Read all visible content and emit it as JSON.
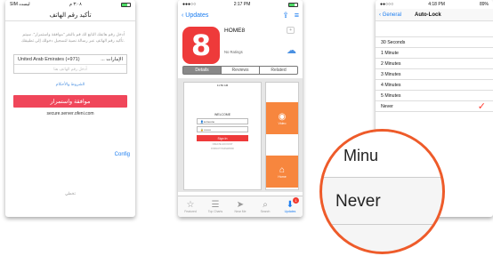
{
  "phone1": {
    "status": {
      "carrier": "SIM ليست",
      "time": "٣:٠٨ م"
    },
    "title": "تأكيد رقم الهاتف",
    "description": "أدخل رقم هاتفك التابع لك قم بالنقر \"موافقة واستمرار\". سيتم تأكيد رقم الهاتف عبر رسالة نصية لتسجيل دخولك إلى تطبيقك.",
    "country_left": "United Arab Emirates (+971)",
    "country_right": "... الإمارات",
    "phone_placeholder": "أدخل رقم الهاتف هنا",
    "terms": "الشروط والأحكام",
    "agree_button": "موافقة واستمرار",
    "site": "secure.server.ofeni.com",
    "config": "Config",
    "skip": "تخطي"
  },
  "phone2": {
    "status": {
      "carrier": "●●●○○",
      "time": "2:17 PM"
    },
    "back": "Updates",
    "app_icon_glyph": "8",
    "app_name": "HOME8",
    "ratings": "No Ratings",
    "plus_badge": "+",
    "tabs": [
      "Details",
      "Reviews",
      "Related"
    ],
    "shot": {
      "time": "11:50 AM",
      "welcome": "WELCOME",
      "username": "someone",
      "password": "••••••••",
      "signin": "Sign In",
      "links": [
        "CREATE ACCOUNT",
        "FORGOT PASSWORD"
      ]
    },
    "tiles": [
      "Video",
      "Home"
    ],
    "tabbar": [
      {
        "label": "Featured",
        "icon": "☆"
      },
      {
        "label": "Top Charts",
        "icon": "☰"
      },
      {
        "label": "Near Me",
        "icon": "➤"
      },
      {
        "label": "Search",
        "icon": "⌕"
      },
      {
        "label": "Updates",
        "icon": "⬇",
        "badge": "1"
      }
    ]
  },
  "phone3": {
    "status": {
      "carrier": "●●○○○",
      "time": "4:18 PM",
      "battery": "89%"
    },
    "back": "General",
    "title": "Auto-Lock",
    "options": [
      "30 Seconds",
      "1 Minute",
      "2 Minutes",
      "3 Minutes",
      "4 Minutes",
      "5 Minutes",
      "Never"
    ],
    "selected": "Never"
  },
  "magnifier": {
    "partial": "Minu",
    "never": "Never"
  },
  "colors": {
    "accent_red": "#f0465a",
    "ios_blue": "#1a7cf0",
    "magnifier_ring": "#ee5b2a",
    "check": "#ff3b30"
  }
}
